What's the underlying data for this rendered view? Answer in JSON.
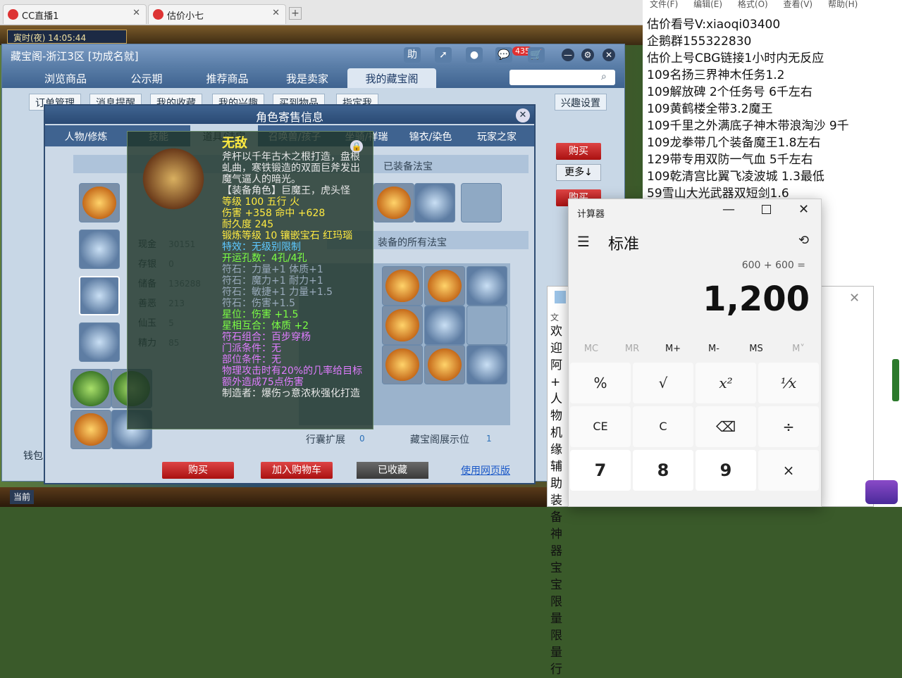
{
  "browser": {
    "tabs": [
      {
        "label": "CC直播1"
      },
      {
        "label": "估价小七"
      }
    ],
    "new_tab": "+"
  },
  "game": {
    "clock": "寅时(夜)  14:05:44"
  },
  "cbg": {
    "title": "藏宝阁-浙江3区 [功成名就]",
    "title_icons": {
      "help": "助",
      "cart_count": "435"
    },
    "nav": [
      "浏览商品",
      "公示期",
      "推荐商品",
      "我是卖家",
      "我的藏宝阁"
    ],
    "subtabs": [
      "订单管理",
      "消息提醒",
      "我的收藏",
      "我的兴趣",
      "买到物品",
      "指定我"
    ],
    "interest_btn": "兴趣设置",
    "buy_label": "购买",
    "more_label": "更多↓",
    "bottom_left": "钱包"
  },
  "dialog": {
    "title": "角色寄售信息",
    "tabs": [
      "人物/修炼",
      "技能",
      "道具/法宝",
      "召唤兽/孩子",
      "坐骑/祥瑞",
      "锦衣/染色",
      "玩家之家"
    ],
    "equipped_fabao_header": "已装备法宝",
    "all_fabao_header": "装备的所有法宝",
    "stats": [
      {
        "k": "现金",
        "v": "30151"
      },
      {
        "k": "存银",
        "v": "0"
      },
      {
        "k": "储备",
        "v": "136288"
      },
      {
        "k": "善恶",
        "v": "213"
      },
      {
        "k": "仙玉",
        "v": "5"
      },
      {
        "k": "精力",
        "v": "85"
      }
    ],
    "bag_expand_label": "行囊扩展",
    "bag_expand_value": "0",
    "display_label": "藏宝阁展示位",
    "display_value": "1",
    "buttons": {
      "buy": "购买",
      "add_cart": "加入购物车",
      "collected": "已收藏",
      "web": "使用网页版"
    }
  },
  "tooltip": {
    "name": "无敌",
    "desc": "斧杆以千年古木之根打造，盘根虬曲，寒铁锻造的双面巨斧发出魔气逼人的暗光。",
    "role": "【装备角色】巨魔王，虎头怪",
    "lines": [
      {
        "t": "等级 100  五行 火",
        "c": "ty"
      },
      {
        "t": "伤害 +358 命中 +628",
        "c": "ty"
      },
      {
        "t": "耐久度 245",
        "c": "ty"
      },
      {
        "t": "锻炼等级 10  镶嵌宝石 红玛瑙",
        "c": "ty"
      },
      {
        "t": "特效：无级别限制",
        "c": "tb"
      },
      {
        "t": "开运孔数：4孔/4孔",
        "c": "tg"
      },
      {
        "t": "符石：力量+1 体质+1",
        "c": "tgrey"
      },
      {
        "t": "符石：魔力+1 耐力+1",
        "c": "tgrey"
      },
      {
        "t": "符石：敏捷+1 力量+1.5",
        "c": "tgrey"
      },
      {
        "t": "符石：伤害+1.5",
        "c": "tgrey"
      },
      {
        "t": "星位：伤害 +1.5",
        "c": "tg"
      },
      {
        "t": "星相互合：体质 +2",
        "c": "tg"
      },
      {
        "t": "符石组合：百步穿杨",
        "c": "tp"
      },
      {
        "t": "门派条件：无",
        "c": "tp"
      },
      {
        "t": "部位条件：无",
        "c": "tp"
      },
      {
        "t": "物理攻击时有20%的几率给目标额外造成75点伤害",
        "c": "tp"
      },
      {
        "t": "制造者：爆伤っ意浓秋强化打造",
        "c": "tw"
      }
    ]
  },
  "notepad": {
    "menu": [
      "文件(F)",
      "编辑(E)",
      "格式(O)",
      "查看(V)",
      "帮助(H)"
    ],
    "lines": [
      "估价看号V:xiaoqi03400",
      "企鹅群155322830",
      "估价上号CBG链接1小时内无反应",
      "109名扬三界神木任务1.2",
      "109解放碑 2个任务号 6千左右",
      "109黄鹤楼全带3.2魔王",
      "109千里之外满底子神木带浪淘沙 9千",
      "109龙拳带几个装备魔王1.8左右",
      "129带专用双防一气血 5千左右",
      "109乾清宫比翼飞凌波城 1.3最低",
      "59雪山大光武器双短剑1.6"
    ]
  },
  "calculator": {
    "window_title": "计算器",
    "mode": "标准",
    "expression": "600 + 600 =",
    "display": "1,200",
    "memory": [
      "MC",
      "MR",
      "M+",
      "M-",
      "MS",
      "M˅"
    ],
    "keys": [
      [
        "%",
        "√",
        "x²",
        "¹⁄x"
      ],
      [
        "CE",
        "C",
        "⌫",
        "÷"
      ],
      [
        "7",
        "8",
        "9",
        "×"
      ]
    ]
  },
  "window2": {
    "lines": [
      "文",
      "欢迎",
      "阿+",
      "人物",
      "机缘",
      "辅助",
      "装备",
      "神器",
      "宝宝",
      "限量",
      "限量",
      "行"
    ]
  },
  "bottom": {
    "current": "当前"
  }
}
